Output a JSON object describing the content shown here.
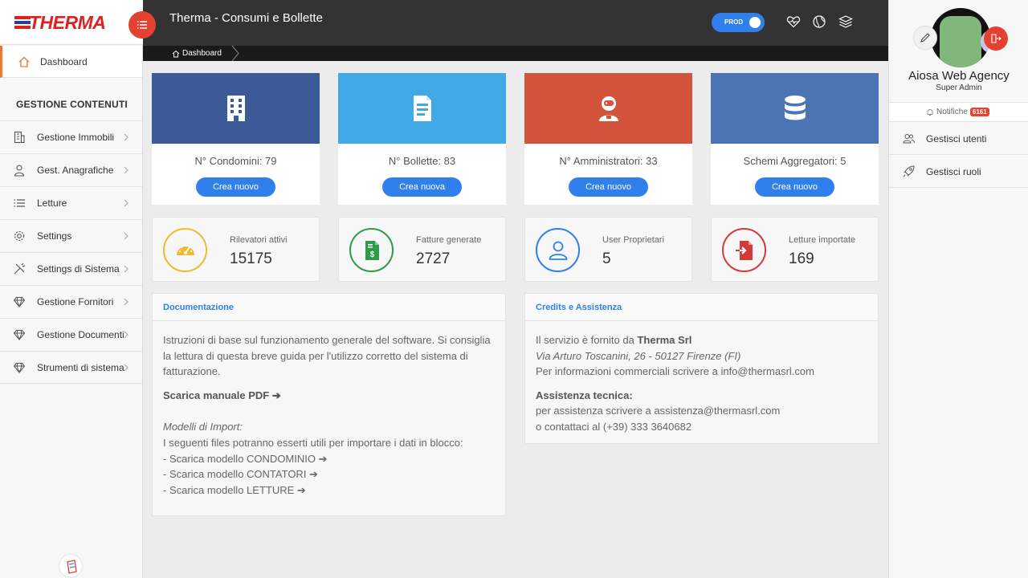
{
  "app": {
    "logo_text": "THERMA",
    "title": "Therma - Consumi e Bollette",
    "env_toggle": "PROD"
  },
  "colors": {
    "accent": "#2f80ed",
    "header": "#333333",
    "brand_red": "#e2422f",
    "active_border": "#ec7a2a",
    "card_blue_dark": "#3c5a98",
    "card_blue_light": "#41a9e6",
    "card_red": "#d4533c",
    "card_blue_mid": "#4a74b4"
  },
  "header_icons": [
    "heart-pulse-icon",
    "globe-icon",
    "layers-icon"
  ],
  "breadcrumb": {
    "label": "Dashboard"
  },
  "sidebar": {
    "active": {
      "label": "Dashboard",
      "icon": "home-icon"
    },
    "section_title": "GESTIONE CONTENUTI",
    "items": [
      {
        "label": "Gestione Immobili",
        "icon": "building-icon"
      },
      {
        "label": "Gest. Anagrafiche",
        "icon": "user-icon"
      },
      {
        "label": "Letture",
        "icon": "list-icon"
      },
      {
        "label": "Settings",
        "icon": "gear-icon"
      },
      {
        "label": "Settings di Sistema",
        "icon": "tools-icon"
      },
      {
        "label": "Gestione Fornitori",
        "icon": "diamond-icon"
      },
      {
        "label": "Gestione Documenti",
        "icon": "diamond-icon"
      },
      {
        "label": "Strumenti di sistema",
        "icon": "diamond-icon"
      }
    ]
  },
  "top_cards": [
    {
      "label": "N° Condomini: 79",
      "button": "Crea nuovo",
      "icon": "building-icon"
    },
    {
      "label": "N° Bollette: 83",
      "button": "Crea nuova",
      "icon": "document-icon"
    },
    {
      "label": "N° Amministratori: 33",
      "button": "Crea nuovo",
      "icon": "astronaut-icon"
    },
    {
      "label": "Schemi Aggregatori: 5",
      "button": "Crea nuovo",
      "icon": "database-icon"
    }
  ],
  "stat_cards": [
    {
      "title": "Rilevatori attivi",
      "value": "15175",
      "icon": "gauge-icon",
      "color": "#f1b92f"
    },
    {
      "title": "Fatture generate",
      "value": "2727",
      "icon": "invoice-dollar-icon",
      "color": "#2e9b48"
    },
    {
      "title": "User Proprietari",
      "value": "5",
      "icon": "user-icon",
      "color": "#2f80ed"
    },
    {
      "title": "Letture importate",
      "value": "169",
      "icon": "file-import-icon",
      "color": "#d23a3a"
    }
  ],
  "documentation": {
    "title": "Documentazione",
    "intro": "Istruzioni di base sul funzionamento generale del software. Si consiglia la lettura di questa breve guida per l'utilizzo corretto del sistema di fatturazione.",
    "manual_link": "Scarica manuale PDF ➔",
    "models_title": "Modelli di Import:",
    "models_intro": "I seguenti files potranno esserti utili per importare i dati in blocco:",
    "models": [
      "- Scarica modello CONDOMINIO ➔",
      "- Scarica modello CONTATORI ➔",
      "- Scarica modello LETTURE ➔"
    ]
  },
  "credits": {
    "title": "Credits e Assistenza",
    "line1_prefix": "Il servizio è fornito da ",
    "line1_company": "Therma Srl",
    "address": "Via Arturo Toscanini, 26 - 50127 Firenze (FI)",
    "commercial": "Per informazioni commerciali scrivere a info@thermasrl.com",
    "support_title": "Assistenza tecnica:",
    "support_email": "per assistenza scrivere a assistenza@thermasrl.com",
    "support_phone": "o contattaci al (+39) 333 3640682"
  },
  "user": {
    "name": "Aiosa Web Agency",
    "role": "Super Admin",
    "notifications_label": "Notifiche",
    "notifications_count": "6161"
  },
  "right_menu": [
    {
      "label": "Gestisci utenti",
      "icon": "users-icon"
    },
    {
      "label": "Gestisci ruoli",
      "icon": "rocket-icon"
    }
  ]
}
